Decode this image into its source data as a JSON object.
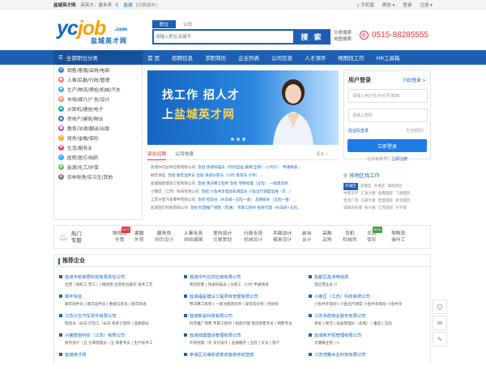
{
  "topbar": {
    "site_name": "盐城英才网",
    "tagline": "英英才，赢未来",
    "city": "盐城",
    "switch_city": "[切换城市]",
    "mobile": "手机版",
    "wechat": "微信",
    "login": "登录",
    "register": "注册"
  },
  "logo": {
    "brand_a": "yc",
    "brand_b": "job",
    "dotcom": ".com",
    "cn_name": "盐城英才网"
  },
  "search": {
    "tabs": [
      "职位",
      "公司"
    ],
    "placeholder": "请输入职位关键字",
    "button": "搜 索",
    "side_links": [
      "分类搜索",
      "地图搜索"
    ]
  },
  "phone": "0515-88285555",
  "nav": {
    "all_categories": "全部职位分类",
    "items": [
      "首 页",
      "招聘信息",
      "求职简历",
      "企业列表",
      "公司信息",
      "人才测评",
      "地图找工作",
      "HR工具箱"
    ]
  },
  "categories": [
    "销售/客服/采购/电商",
    "人事/后勤/行政/管理",
    "生产/物流/质检/机械/汽车",
    "市场/媒介/广告/设计",
    "计算机/通信/电子",
    "房地产/建筑/物业",
    "教育/法律/翻译/出版",
    "财务/金融/保险",
    "生活/服务业",
    "医院/医疗/制药",
    "能源/化工/环保",
    "农林牧渔/实习生/其他"
  ],
  "banner": {
    "line1": "找工作  招人才",
    "line2_a": "上",
    "line2_b": "盐城英才网"
  },
  "recruit": {
    "tabs": [
      "紧急招聘",
      "公司信息"
    ],
    "more": "更多 »",
    "rows": [
      {
        "company": "盐城中可达供应链有限公司",
        "jobs": "急招  快递扫描员（时间自由 兼职/全职）（小时工）  申通快递..."
      },
      {
        "company": "顺丰快运",
        "jobs": "急招  顺丰运件员  急招  快递分拣员（小时  拣货员  计件）..."
      },
      {
        "company": "盐城福星建设工程有限公司",
        "jobs": "急招  预决算工程师  急招  项目经理（五险）  一级建造师..."
      },
      {
        "company": "小南区（江苏）科技有限公司",
        "jobs": "急招  小鱼共享电动车调度员  小鱼出行调度运维（可...）"
      },
      {
        "company": "江苏兴宝汽车零件有限公司",
        "jobs": "急招  检验员（长白班+五险一金）  品质部长（五险一金）..."
      },
      {
        "company": "盐城亚们科技有限公司",
        "jobs": "急招  科普推广销售（普通）  专职工程师  招商代理（长白班+五险..."
      }
    ]
  },
  "login": {
    "title": "用户登录",
    "scan": "扫码登录 >",
    "user_placeholder": "请输入用户名/手机号/邮箱",
    "pass_placeholder": "请输入密码",
    "code_login": "验证码登录",
    "forgot": "忘记密码？",
    "button": "立即登录",
    "no_account": "还没有账号？",
    "register_now": "立即注册"
  },
  "area": {
    "title": "按地区找工作",
    "rows": [
      [
        "亭湖区",
        "盐都区",
        "开发区",
        "城南新区"
      ],
      [
        "中南华宇",
        "汇金大厦",
        "金鹰国际",
        "飞驰国际"
      ],
      [
        "宝龙广场",
        "交通大厦",
        "宏图国际",
        "新华国际"
      ],
      [
        "城南商务城",
        "振兴路",
        "江苏国际",
        "大学城"
      ]
    ]
  },
  "quick": {
    "hot_label_1": "热门",
    "hot_label_2": "专题",
    "cols": [
      {
        "top": "物流司",
        "bottom": "仓管",
        "badge": "HOT"
      },
      {
        "top": "客服",
        "bottom": "外贸",
        "badge": ""
      },
      {
        "top": "服务员",
        "bottom": "网页设计",
        "badge": ""
      },
      {
        "top": "人事专员",
        "bottom": "网络编辑",
        "badge": ""
      },
      {
        "top": "室内设计",
        "bottom": "文案策划",
        "badge": ""
      },
      {
        "top": "行政专员",
        "bottom": "机械设计",
        "badge": ""
      },
      {
        "top": "平面设计",
        "bottom": "模具设计",
        "badge": ""
      },
      {
        "top": "前台",
        "bottom": "会计",
        "badge": ""
      },
      {
        "top": "采购",
        "bottom": "采购",
        "badge": ""
      },
      {
        "top": "司机",
        "bottom": "机械师",
        "badge": ""
      },
      {
        "top": "文员",
        "bottom": "保安",
        "badge": "NEW"
      },
      {
        "top": "导购员",
        "bottom": "操作工",
        "badge": ""
      }
    ]
  },
  "recommend": {
    "title": "推荐企业",
    "companies": [
      {
        "name": "盐城丰稻家居科技有限责任公司",
        "jobs": "注塑（调机工 普工）| 模具附 注塑机台操作 技术工艺"
      },
      {
        "name": "盐城中可达供应链有限公司",
        "jobs": "物流装卸 | 快递扫描员 | 分拣工（小时 申通快递"
      },
      {
        "name": "盐都区盐渎电信局",
        "jobs": "电信营业员 ()"
      },
      {
        "name": "顺丰快运",
        "jobs": "顺丰收件员 | 顺丰运件员 | 数据信息员 | 顺丰快递"
      },
      {
        "name": "盐城福星建设工程项目管理有限公司",
        "jobs": "预决算工程师 | 一级注册建造师 | 安装造价师 | 招投标"
      },
      {
        "name": "小南区（江苏）科技有限公司",
        "jobs": "小鱼共享电动 | 小鱼出行调度 小鱼共享电动 小鱼共享"
      },
      {
        "name": "江苏兴宝汽车零件有限公司",
        "jobs": "检验员（长白 打包工（长白 体系工程师 | 品质部长"
      },
      {
        "name": "盐城新星科技有限公司",
        "jobs": "科普推广销售 专职工程师 | 招商代理 电话销售专员 | 销售专员"
      },
      {
        "name": "江苏永胜物业服务有限公司",
        "jobs": "保安 | 保洁 | 宿舍管理员（盐城） | 垂后 | 五险"
      },
      {
        "name": "兴盛智能科技（江苏）有限公司",
        "jobs": "财务会计（五 仓库管理员（五 销售专员 | 生产技术工"
      },
      {
        "name": "盐城城建建设管理有限公司",
        "jobs": "外贸经理（外 支付设计 | 品质服务 | 五险 | 文员 | 客户"
      },
      {
        "name": "盐城新开拓管理有限公司",
        "jobs": "大健康主管 | ()"
      },
      {
        "name": "盐城英才网",
        "jobs": ""
      },
      {
        "name": "亭湖区文峰街道季成富装修经营部",
        "jobs": ""
      },
      {
        "name": "江苏茂鹏木业科技有限公司",
        "jobs": ""
      }
    ]
  },
  "colors": {
    "primary": "#1e5fb4",
    "accent": "#e53935",
    "logo_orange": "#f5a200"
  },
  "icons": [
    "location-pin-icon",
    "mobile-icon",
    "wechat-icon",
    "phone-icon",
    "menu-icon",
    "fire-icon",
    "wechat-float-icon",
    "message-icon",
    "feedback-icon"
  ]
}
